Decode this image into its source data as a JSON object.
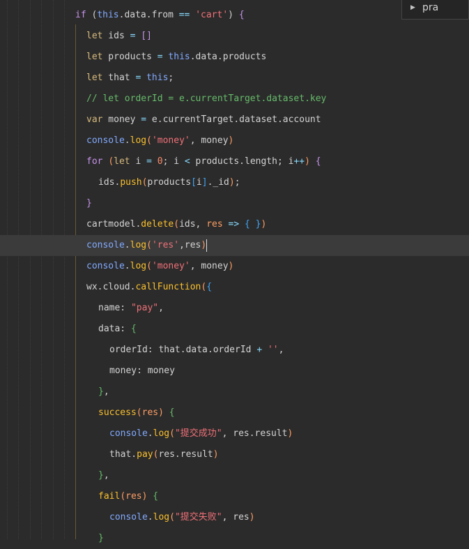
{
  "autocomplete": {
    "expand_icon": "triangle-right-icon",
    "item_label": "pra"
  },
  "lines": [
    {
      "indent": 108,
      "tokens": [
        [
          "kw",
          "if"
        ],
        [
          "plain",
          " ("
        ],
        [
          "obj",
          "this"
        ],
        [
          "plain",
          ".data.from "
        ],
        [
          "op",
          "=="
        ],
        [
          "plain",
          " "
        ],
        [
          "str",
          "'cart'"
        ],
        [
          "plain",
          ") "
        ],
        [
          "br",
          "{"
        ]
      ]
    },
    {
      "indent": 124,
      "tokens": [
        [
          "kw2",
          "let"
        ],
        [
          "plain",
          " ids "
        ],
        [
          "op",
          "="
        ],
        [
          "plain",
          " "
        ],
        [
          "br",
          "[]"
        ]
      ]
    },
    {
      "indent": 124,
      "tokens": [
        [
          "kw2",
          "let"
        ],
        [
          "plain",
          " products "
        ],
        [
          "op",
          "="
        ],
        [
          "plain",
          " "
        ],
        [
          "obj",
          "this"
        ],
        [
          "plain",
          ".data.products"
        ]
      ]
    },
    {
      "indent": 124,
      "tokens": [
        [
          "kw2",
          "let"
        ],
        [
          "plain",
          " that "
        ],
        [
          "op",
          "="
        ],
        [
          "plain",
          " "
        ],
        [
          "obj",
          "this"
        ],
        [
          "plain",
          ";"
        ]
      ]
    },
    {
      "indent": 124,
      "tokens": [
        [
          "cm",
          "// let orderId = e.currentTarget.dataset.key"
        ]
      ]
    },
    {
      "indent": 124,
      "tokens": [
        [
          "kw2",
          "var"
        ],
        [
          "plain",
          " money "
        ],
        [
          "op",
          "="
        ],
        [
          "plain",
          " e.currentTarget.dataset.account"
        ]
      ]
    },
    {
      "indent": 124,
      "tokens": [
        [
          "obj",
          "console"
        ],
        [
          "plain",
          "."
        ],
        [
          "fn",
          "log"
        ],
        [
          "par",
          "("
        ],
        [
          "str",
          "'money'"
        ],
        [
          "plain",
          ", money"
        ],
        [
          "par",
          ")"
        ]
      ]
    },
    {
      "indent": 124,
      "tokens": [
        [
          "kw",
          "for"
        ],
        [
          "plain",
          " "
        ],
        [
          "par",
          "("
        ],
        [
          "kw2",
          "let"
        ],
        [
          "plain",
          " i "
        ],
        [
          "op",
          "="
        ],
        [
          "plain",
          " "
        ],
        [
          "num",
          "0"
        ],
        [
          "plain",
          "; i "
        ],
        [
          "op",
          "<"
        ],
        [
          "plain",
          " products.length; i"
        ],
        [
          "op",
          "++"
        ],
        [
          "par",
          ")"
        ],
        [
          "plain",
          " "
        ],
        [
          "br",
          "{"
        ]
      ]
    },
    {
      "indent": 141,
      "tokens": [
        [
          "plain",
          "ids."
        ],
        [
          "fn",
          "push"
        ],
        [
          "par",
          "("
        ],
        [
          "plain",
          "products"
        ],
        [
          "br3",
          "["
        ],
        [
          "plain",
          "i"
        ],
        [
          "br3",
          "]"
        ],
        [
          "plain",
          "._id"
        ],
        [
          "par",
          ")"
        ],
        [
          "plain",
          ";"
        ]
      ]
    },
    {
      "indent": 124,
      "tokens": [
        [
          "br",
          "}"
        ]
      ]
    },
    {
      "indent": 124,
      "tokens": [
        [
          "plain",
          "cartmodel."
        ],
        [
          "fn",
          "delete"
        ],
        [
          "par",
          "("
        ],
        [
          "plain",
          "ids, "
        ],
        [
          "par",
          "res"
        ],
        [
          "plain",
          " "
        ],
        [
          "op",
          "=>"
        ],
        [
          "plain",
          " "
        ],
        [
          "br3",
          "{ }"
        ],
        [
          "par",
          ")"
        ]
      ]
    },
    {
      "indent": 124,
      "highlight": true,
      "tokens": [
        [
          "obj",
          "console"
        ],
        [
          "plain",
          "."
        ],
        [
          "fn",
          "log"
        ],
        [
          "par",
          "("
        ],
        [
          "str",
          "'res'"
        ],
        [
          "plain",
          ",res"
        ],
        [
          "par",
          ")"
        ]
      ]
    },
    {
      "indent": 124,
      "tokens": [
        [
          "obj",
          "console"
        ],
        [
          "plain",
          "."
        ],
        [
          "fn",
          "log"
        ],
        [
          "par",
          "("
        ],
        [
          "str",
          "'money'"
        ],
        [
          "plain",
          ", money"
        ],
        [
          "par",
          ")"
        ]
      ]
    },
    {
      "indent": 124,
      "tokens": [
        [
          "plain",
          "wx.cloud."
        ],
        [
          "fn",
          "callFunction"
        ],
        [
          "par",
          "("
        ],
        [
          "br3",
          "{"
        ]
      ]
    },
    {
      "indent": 141,
      "tokens": [
        [
          "plain",
          "name: "
        ],
        [
          "str",
          "\"pay\""
        ],
        [
          "plain",
          ","
        ]
      ]
    },
    {
      "indent": 141,
      "tokens": [
        [
          "plain",
          "data: "
        ],
        [
          "br2",
          "{"
        ]
      ]
    },
    {
      "indent": 157,
      "tokens": [
        [
          "plain",
          "orderId: that.data.orderId "
        ],
        [
          "op",
          "+"
        ],
        [
          "plain",
          " "
        ],
        [
          "str",
          "''"
        ],
        [
          "plain",
          ","
        ]
      ]
    },
    {
      "indent": 157,
      "tokens": [
        [
          "plain",
          "money: money"
        ]
      ]
    },
    {
      "indent": 141,
      "tokens": [
        [
          "br2",
          "}"
        ],
        [
          "plain",
          ","
        ]
      ]
    },
    {
      "indent": 141,
      "tokens": [
        [
          "fn",
          "success"
        ],
        [
          "par",
          "("
        ],
        [
          "par",
          "res"
        ],
        [
          "par",
          ")"
        ],
        [
          "plain",
          " "
        ],
        [
          "br2",
          "{"
        ]
      ]
    },
    {
      "indent": 157,
      "tokens": [
        [
          "obj",
          "console"
        ],
        [
          "plain",
          "."
        ],
        [
          "fn",
          "log"
        ],
        [
          "par",
          "("
        ],
        [
          "str",
          "\"提交成功\""
        ],
        [
          "plain",
          ", res.result"
        ],
        [
          "par",
          ")"
        ]
      ]
    },
    {
      "indent": 157,
      "tokens": [
        [
          "plain",
          "that."
        ],
        [
          "fn",
          "pay"
        ],
        [
          "par",
          "("
        ],
        [
          "plain",
          "res.result"
        ],
        [
          "par",
          ")"
        ]
      ]
    },
    {
      "indent": 141,
      "tokens": [
        [
          "br2",
          "}"
        ],
        [
          "plain",
          ","
        ]
      ]
    },
    {
      "indent": 141,
      "tokens": [
        [
          "fn",
          "fail"
        ],
        [
          "par",
          "("
        ],
        [
          "par",
          "res"
        ],
        [
          "par",
          ")"
        ],
        [
          "plain",
          " "
        ],
        [
          "br2",
          "{"
        ]
      ]
    },
    {
      "indent": 157,
      "tokens": [
        [
          "obj",
          "console"
        ],
        [
          "plain",
          "."
        ],
        [
          "fn",
          "log"
        ],
        [
          "par",
          "("
        ],
        [
          "str",
          "\"提交失败\""
        ],
        [
          "plain",
          ", res"
        ],
        [
          "par",
          ")"
        ]
      ]
    },
    {
      "indent": 141,
      "tokens": [
        [
          "br2",
          "}"
        ]
      ]
    }
  ]
}
